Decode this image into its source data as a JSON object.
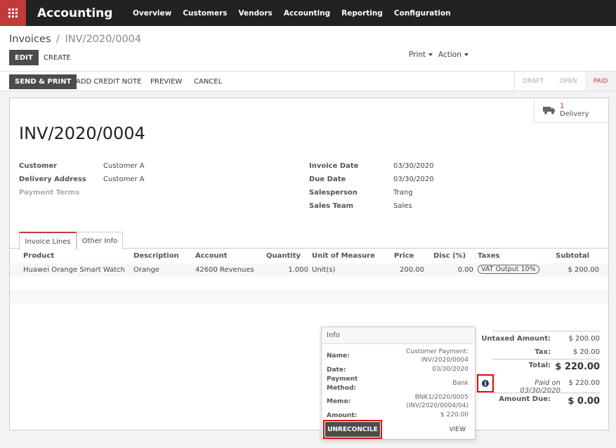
{
  "nav": {
    "app_title": "Accounting",
    "menu": [
      "Overview",
      "Customers",
      "Vendors",
      "Accounting",
      "Reporting",
      "Configuration"
    ]
  },
  "breadcrumb": {
    "parent": "Invoices",
    "separator": "/",
    "current": "INV/2020/0004"
  },
  "control": {
    "edit": "EDIT",
    "create": "CREATE",
    "print": "Print",
    "action": "Action"
  },
  "statusbar": {
    "send_print": "SEND & PRINT",
    "add_credit_note": "ADD CREDIT NOTE",
    "preview": "PREVIEW",
    "cancel": "CANCEL",
    "stages": [
      "DRAFT",
      "OPEN",
      "PAID"
    ],
    "active_stage": "PAID",
    "active_color": "#c23a3a"
  },
  "smart_button": {
    "count": "1",
    "label": "Delivery",
    "icon": "truck-icon"
  },
  "invoice": {
    "number": "INV/2020/0004",
    "left_fields": [
      {
        "label": "Customer",
        "value": "Customer A"
      },
      {
        "label": "Delivery Address",
        "value": "Customer A"
      },
      {
        "label": "Payment Terms",
        "value": ""
      }
    ],
    "right_fields": [
      {
        "label": "Invoice Date",
        "value": "03/30/2020"
      },
      {
        "label": "Due Date",
        "value": "03/30/2020"
      },
      {
        "label": "Salesperson",
        "value": "Trang"
      },
      {
        "label": "Sales Team",
        "value": "Sales"
      }
    ]
  },
  "tabs": [
    "Invoice Lines",
    "Other Info"
  ],
  "lines": {
    "headers": [
      "Product",
      "Description",
      "Account",
      "Quantity",
      "Unit of Measure",
      "Price",
      "Disc (%)",
      "Taxes",
      "Subtotal"
    ],
    "rows": [
      {
        "product": "Huawei Orange Smart Watch",
        "description": "Orange",
        "account": "42600 Revenues",
        "quantity": "1.000",
        "uom": "Unit(s)",
        "price": "200.00",
        "discount": "0.00",
        "tax": "VAT Output 10%",
        "subtotal": "$ 200.00"
      }
    ]
  },
  "totals": {
    "untaxed_label": "Untaxed Amount:",
    "untaxed": "$ 200.00",
    "tax_label": "Tax:",
    "tax": "$ 20.00",
    "total_label": "Total:",
    "total": "$ 220.00",
    "paid_on": "Paid on 03/30/2020",
    "paid_amount": "$ 220.00",
    "due_label": "Amount Due:",
    "due": "$ 0.00"
  },
  "popover": {
    "title": "Info",
    "name_label": "Name:",
    "name_value_1": "Customer Payment:",
    "name_value_2": "INV/2020/0004",
    "date_label": "Date:",
    "date_value": "03/30/2020",
    "method_label_1": "Payment",
    "method_label_2": "Method:",
    "method_value": "Bank",
    "memo_label": "Memo:",
    "memo_value_1": "BNK1/2020/0005",
    "memo_value_2": "(INV/2020/0004/04)",
    "amount_label": "Amount:",
    "amount_value": "$ 220.00",
    "unreconcile": "UNRECONCILE",
    "view": "VIEW"
  }
}
